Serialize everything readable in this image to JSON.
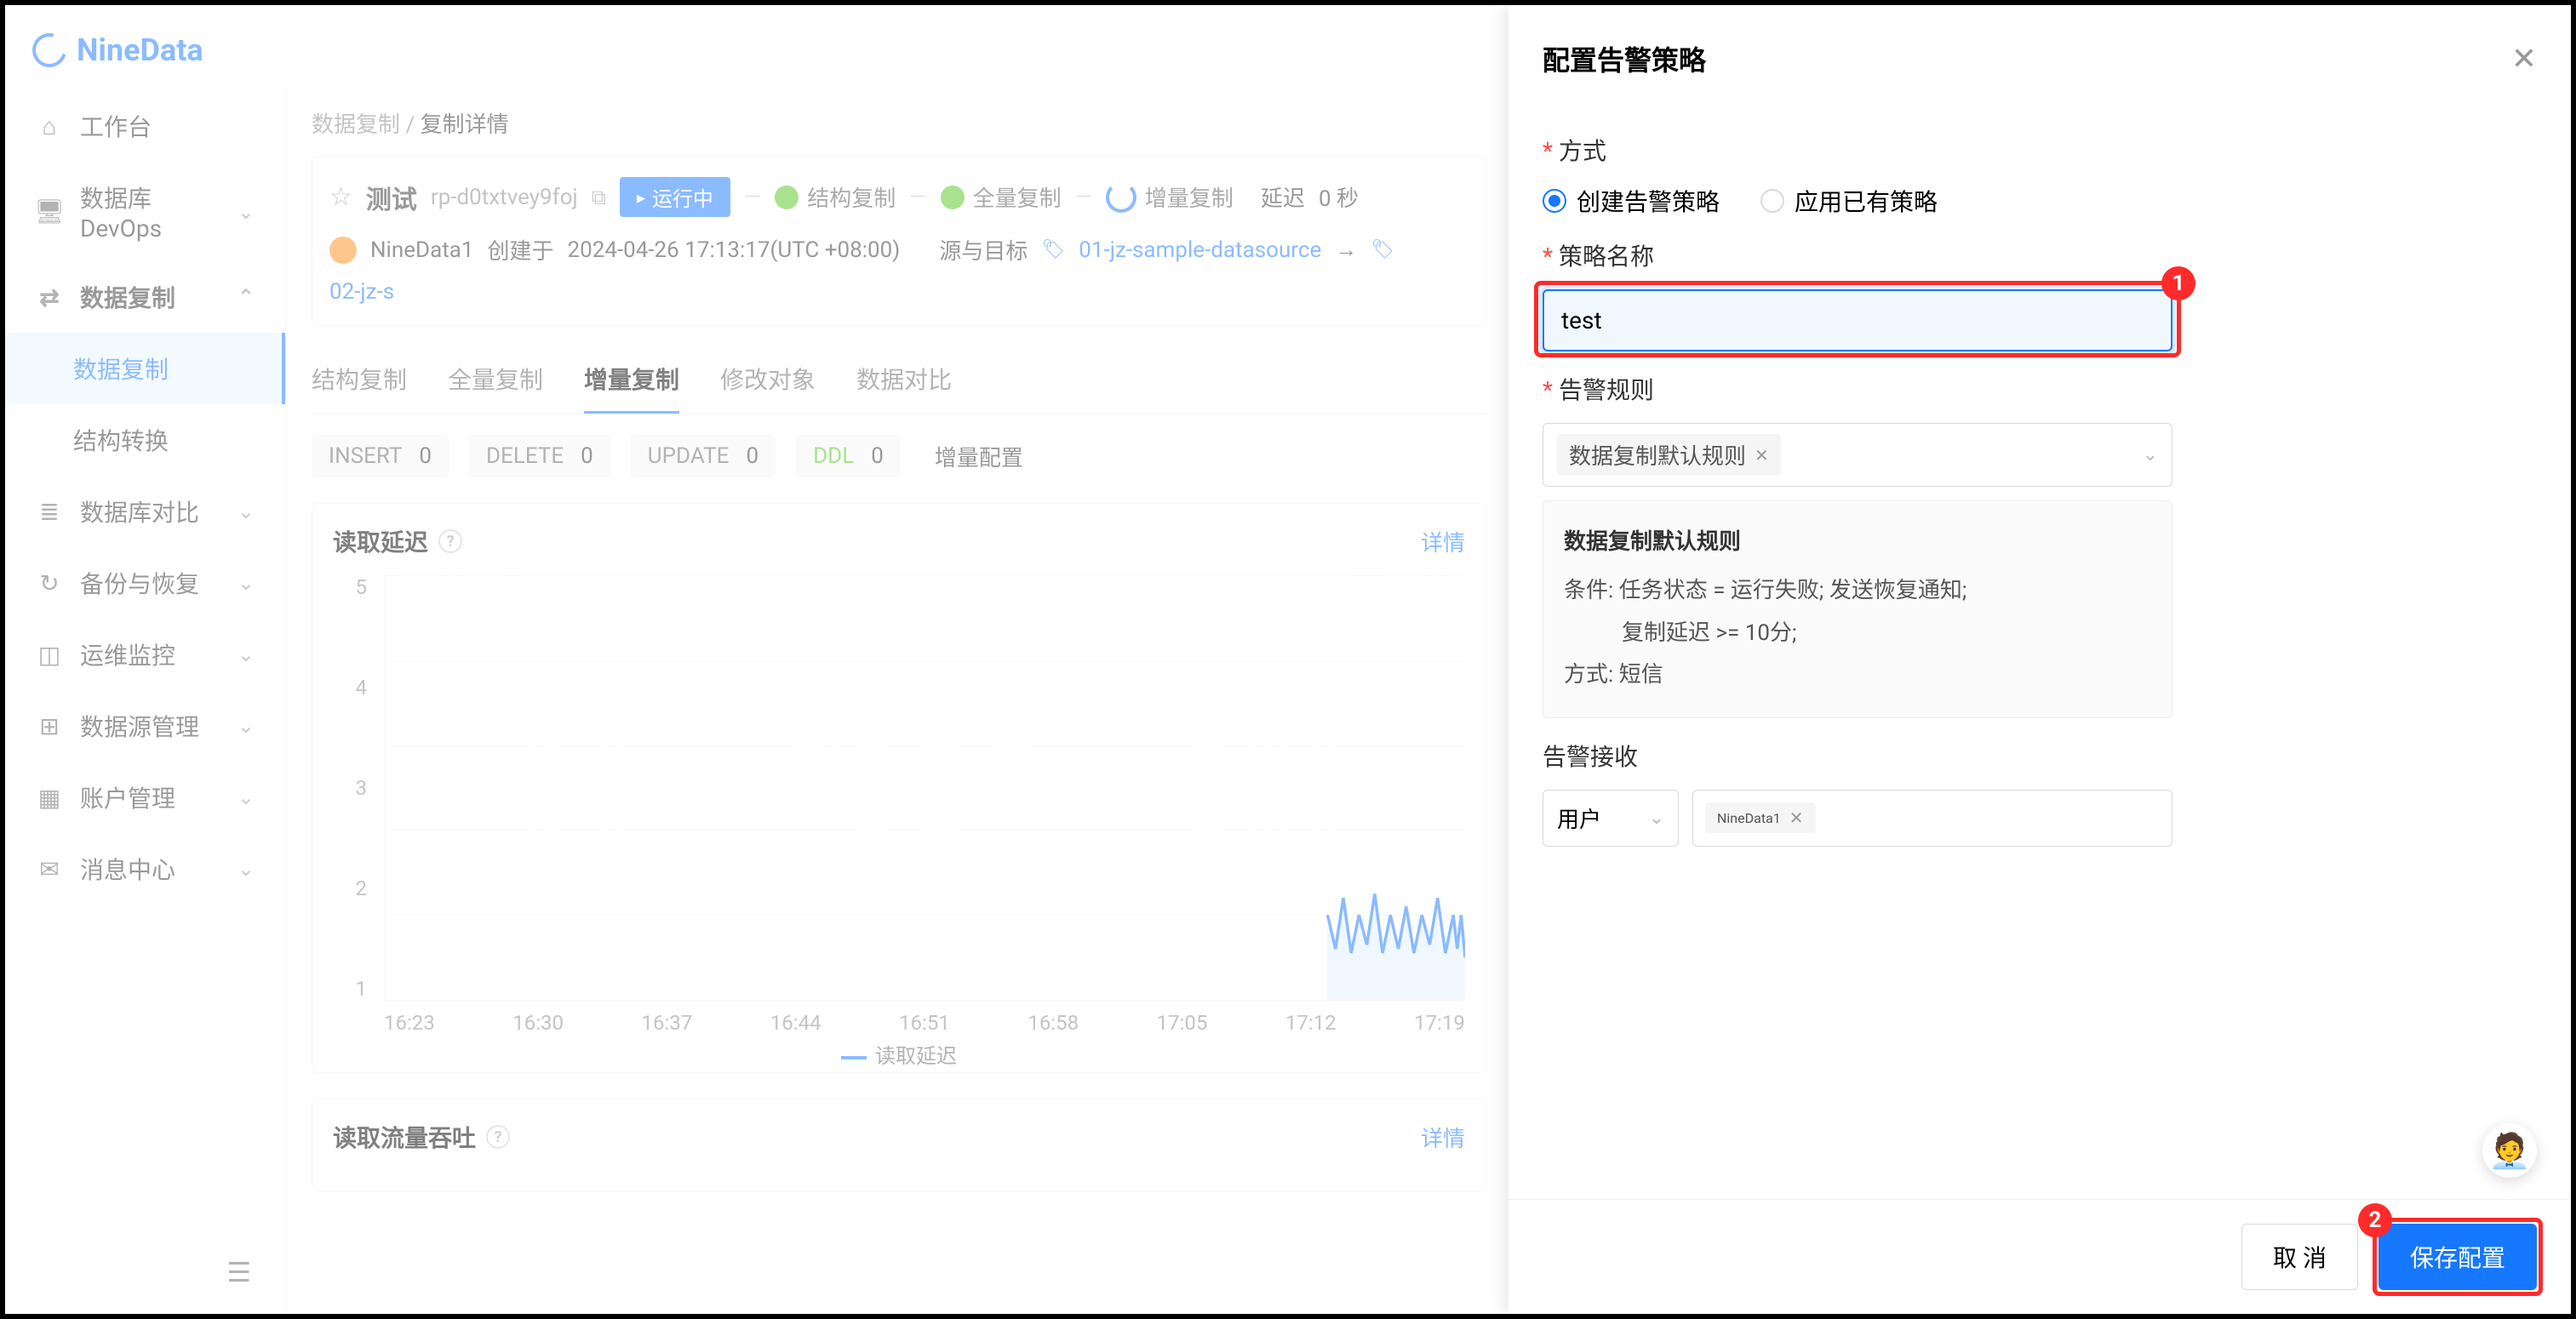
{
  "brand": "NineData",
  "sidebar": {
    "items": [
      {
        "label": "工作台",
        "icon": "⌂"
      },
      {
        "label": "数据库 DevOps",
        "icon": "🖥",
        "chev": "⌄"
      },
      {
        "label": "数据复制",
        "icon": "⇄",
        "chev": "⌃",
        "bold": true
      },
      {
        "label": "数据复制",
        "sub": true,
        "active": true
      },
      {
        "label": "结构转换",
        "sub": true
      },
      {
        "label": "数据库对比",
        "icon": "≣",
        "chev": "⌄"
      },
      {
        "label": "备份与恢复",
        "icon": "↻",
        "chev": "⌄"
      },
      {
        "label": "运维监控",
        "icon": "◫",
        "chev": "⌄"
      },
      {
        "label": "数据源管理",
        "icon": "⊞",
        "chev": "⌄"
      },
      {
        "label": "账户管理",
        "icon": "▦",
        "chev": "⌄"
      },
      {
        "label": "消息中心",
        "icon": "✉",
        "chev": "⌄"
      }
    ]
  },
  "breadcrumb": {
    "parent": "数据复制",
    "sep": "/",
    "current": "复制详情"
  },
  "header": {
    "star": "☆",
    "title": "测试",
    "task_id": "rp-d0txtvey9foj",
    "run_badge": "运行中",
    "steps": [
      {
        "label": "结构复制",
        "ok": true
      },
      {
        "label": "全量复制",
        "ok": true
      },
      {
        "label": "增量复制",
        "prog": true
      }
    ],
    "delay_label": "延迟",
    "delay_value": "0 秒",
    "creator": "NineData1",
    "created_label": "创建于",
    "created_at": "2024-04-26 17:13:17(UTC +08:00)",
    "src_label": "源与目标",
    "src": "01-jz-sample-datasource",
    "dst": "02-jz-s"
  },
  "tabs": [
    "结构复制",
    "全量复制",
    "增量复制",
    "修改对象",
    "数据对比"
  ],
  "active_tab": 2,
  "stats": [
    {
      "label": "INSERT",
      "value": "0"
    },
    {
      "label": "DELETE",
      "value": "0"
    },
    {
      "label": "UPDATE",
      "value": "0"
    },
    {
      "label": "DDL",
      "value": "0",
      "ddl": true
    }
  ],
  "incr_config": "增量配置",
  "charts": {
    "read_delay": {
      "title": "读取延迟",
      "detail": "详情",
      "legend": "读取延迟"
    },
    "throughput": {
      "title": "读取流量吞吐",
      "detail": "详情"
    }
  },
  "chart_data": {
    "type": "line",
    "title": "读取延迟",
    "xlabel": "",
    "ylabel": "",
    "ylim": [
      0,
      5
    ],
    "yticks": [
      1,
      2,
      3,
      4,
      5
    ],
    "categories": [
      "16:23",
      "16:30",
      "16:37",
      "16:44",
      "16:51",
      "16:58",
      "17:05",
      "17:12",
      "17:19"
    ],
    "series": [
      {
        "name": "读取延迟",
        "values": [
          null,
          null,
          null,
          null,
          null,
          null,
          null,
          1,
          1
        ],
        "segment_detail": {
          "start_index": 7,
          "pattern": [
            1,
            0.5,
            1.2,
            0.6,
            1,
            0.7,
            1.3,
            0.5,
            1,
            0.6,
            1.1,
            0.5,
            1,
            0.7,
            1.2,
            0.5,
            1,
            0.6,
            1,
            0.4
          ]
        }
      }
    ]
  },
  "drawer": {
    "title": "配置告警策略",
    "mode_label": "方式",
    "mode_create": "创建告警策略",
    "mode_apply": "应用已有策略",
    "name_label": "策略名称",
    "name_value": "test",
    "rule_label": "告警规则",
    "rule_tag": "数据复制默认规则",
    "rule_detail": {
      "title": "数据复制默认规则",
      "cond_label": "条件:",
      "cond_line1": "任务状态 = 运行失败; 发送恢复通知;",
      "cond_line2": "复制延迟 >= 10分;",
      "method_label": "方式:",
      "method_value": "短信"
    },
    "recv_label": "告警接收",
    "recv_type": "用户",
    "recv_tag": "NineData1",
    "cancel": "取 消",
    "save": "保存配置"
  },
  "callouts": {
    "one": "1",
    "two": "2"
  }
}
